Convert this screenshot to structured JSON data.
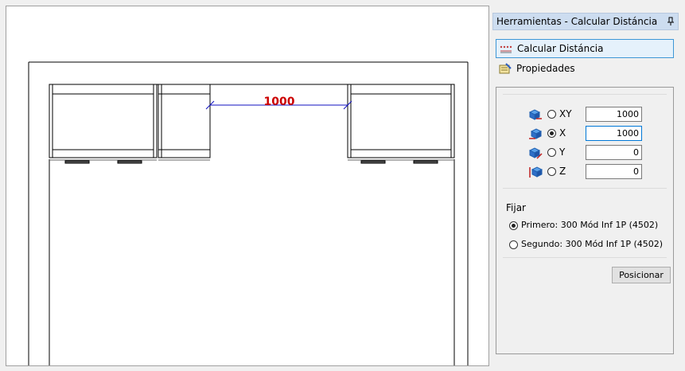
{
  "canvas": {
    "dimension_value": "1000"
  },
  "panel": {
    "title": "Herramientas - Calcular Distáncia",
    "tabs": [
      {
        "label": "Calcular Distáncia",
        "active": true
      },
      {
        "label": "Propiedades",
        "active": false
      }
    ],
    "axes": [
      {
        "label": "XY",
        "value": "1000",
        "selected": false
      },
      {
        "label": "X",
        "value": "1000",
        "selected": true
      },
      {
        "label": "Y",
        "value": "0",
        "selected": false
      },
      {
        "label": "Z",
        "value": "0",
        "selected": false
      }
    ],
    "fix": {
      "label": "Fijar",
      "first": "Primero: 300 Mód Inf 1P (4502)",
      "second": "Segundo: 300 Mód Inf 1P (4502)",
      "selected": "first"
    },
    "position_button": "Posicionar"
  },
  "colors": {
    "dimension_text": "#cc0000",
    "dimension_line": "#1010c0",
    "accent": "#3d97d6"
  }
}
